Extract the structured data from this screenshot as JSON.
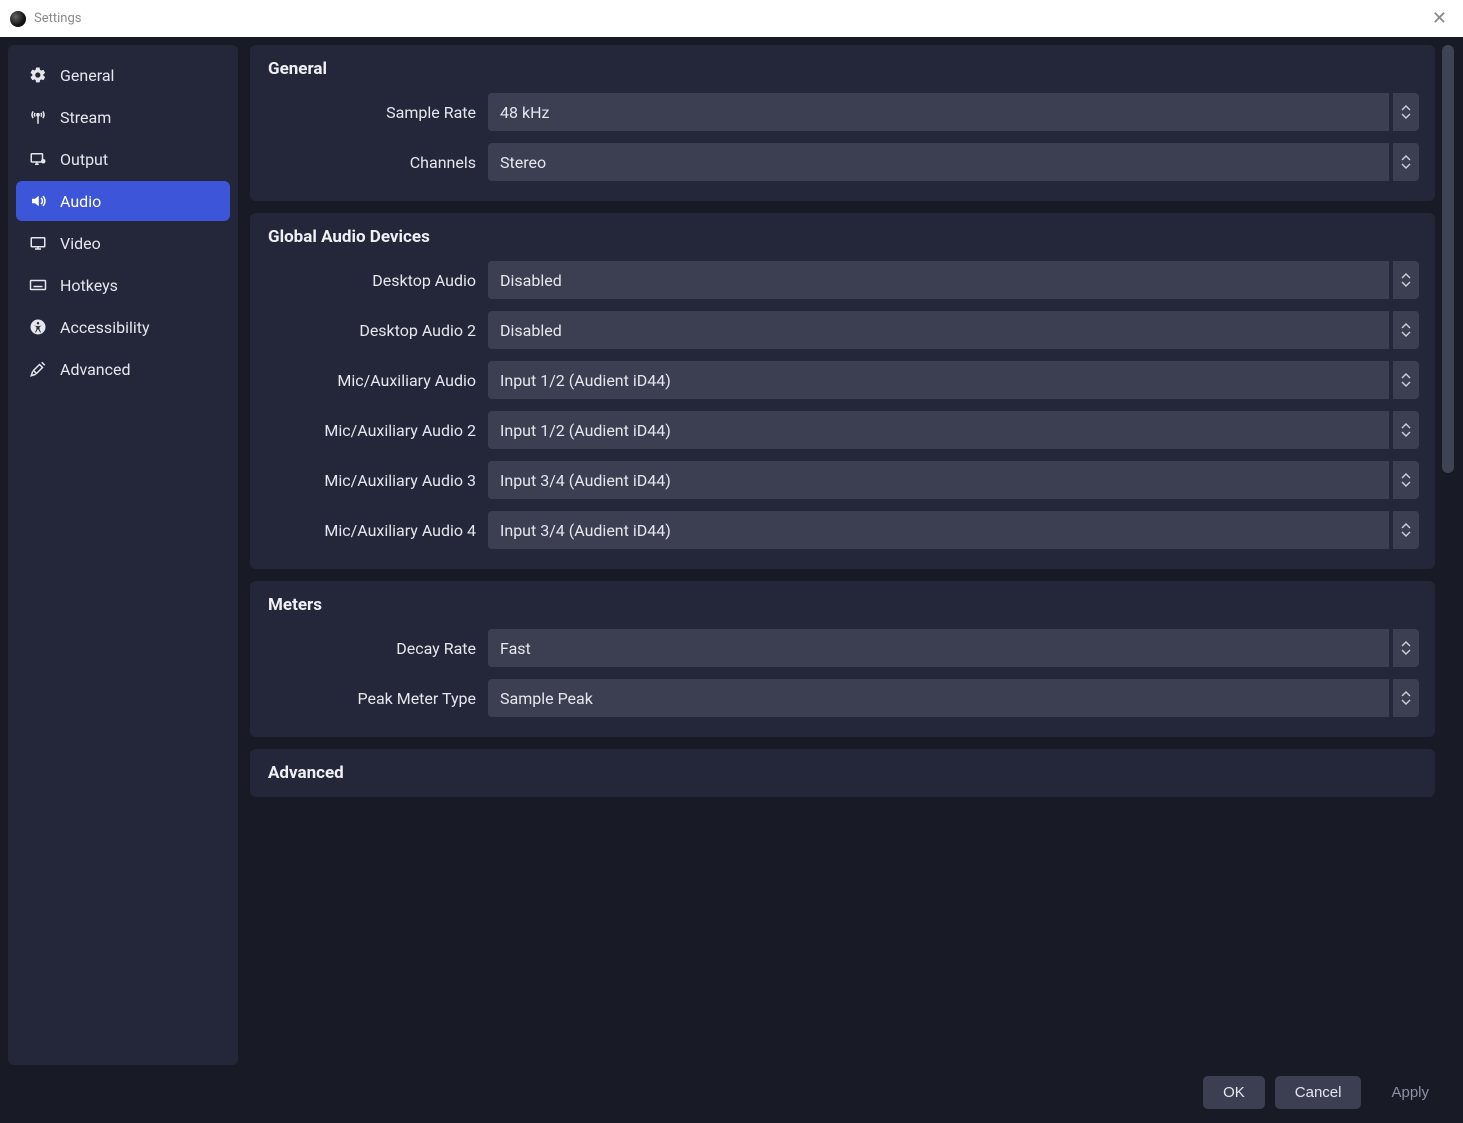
{
  "window": {
    "title": "Settings"
  },
  "sidebar": {
    "items": [
      {
        "id": "general",
        "label": "General"
      },
      {
        "id": "stream",
        "label": "Stream"
      },
      {
        "id": "output",
        "label": "Output"
      },
      {
        "id": "audio",
        "label": "Audio"
      },
      {
        "id": "video",
        "label": "Video"
      },
      {
        "id": "hotkeys",
        "label": "Hotkeys"
      },
      {
        "id": "accessibility",
        "label": "Accessibility"
      },
      {
        "id": "advanced",
        "label": "Advanced"
      }
    ],
    "active": "audio"
  },
  "sections": {
    "general": {
      "title": "General",
      "rows": [
        {
          "label": "Sample Rate",
          "value": "48 kHz"
        },
        {
          "label": "Channels",
          "value": "Stereo"
        }
      ]
    },
    "devices": {
      "title": "Global Audio Devices",
      "rows": [
        {
          "label": "Desktop Audio",
          "value": "Disabled"
        },
        {
          "label": "Desktop Audio 2",
          "value": "Disabled"
        },
        {
          "label": "Mic/Auxiliary Audio",
          "value": "Input 1/2 (Audient iD44)"
        },
        {
          "label": "Mic/Auxiliary Audio 2",
          "value": "Input 1/2 (Audient iD44)"
        },
        {
          "label": "Mic/Auxiliary Audio 3",
          "value": "Input 3/4 (Audient iD44)"
        },
        {
          "label": "Mic/Auxiliary Audio 4",
          "value": "Input 3/4 (Audient iD44)"
        }
      ]
    },
    "meters": {
      "title": "Meters",
      "rows": [
        {
          "label": "Decay Rate",
          "value": "Fast"
        },
        {
          "label": "Peak Meter Type",
          "value": "Sample Peak"
        }
      ]
    },
    "advanced": {
      "title": "Advanced"
    }
  },
  "footer": {
    "ok": "OK",
    "cancel": "Cancel",
    "apply": "Apply"
  }
}
